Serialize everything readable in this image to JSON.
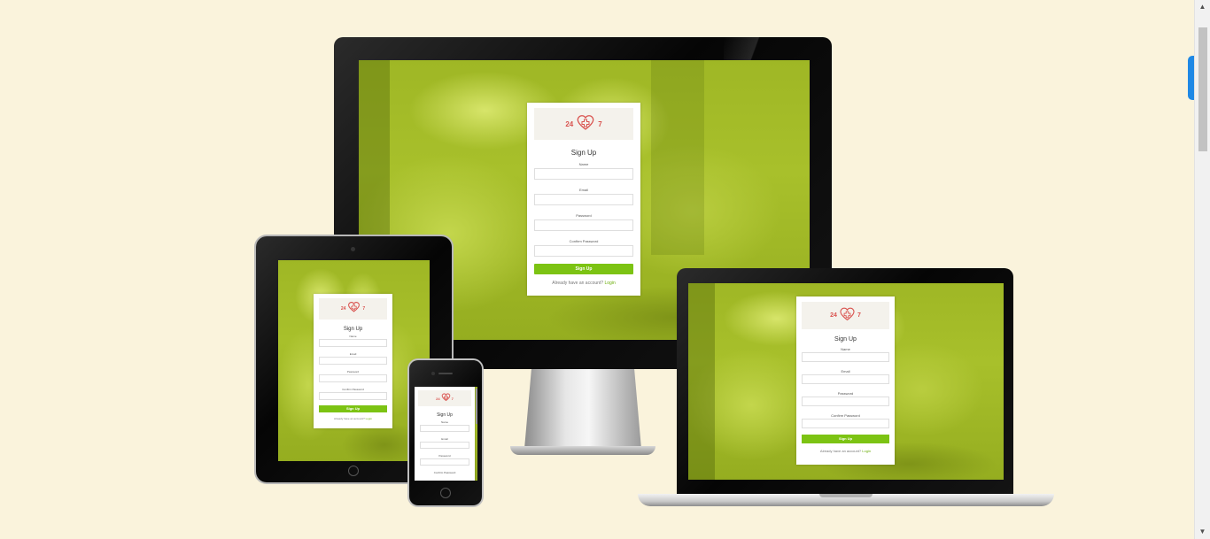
{
  "form": {
    "title": "Sign Up",
    "fields": [
      {
        "label": "Name"
      },
      {
        "label": "Email"
      },
      {
        "label": "Password"
      },
      {
        "label": "Confirm Password"
      }
    ],
    "submit_label": "Sign Up",
    "footer_text": "Already have an account?",
    "footer_link": "Login"
  },
  "logo": {
    "left_num": "24",
    "right_num": "7",
    "icon": "heart-cross-icon"
  },
  "colors": {
    "page_bg": "#faf3dc",
    "overlay_green": "#a7bf2a",
    "button_green": "#7cc313",
    "logo_red": "#d9534f"
  }
}
